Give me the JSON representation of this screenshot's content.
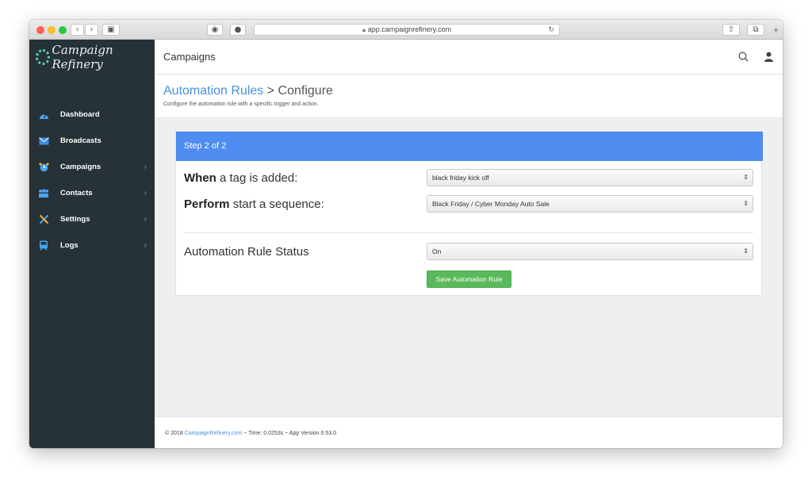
{
  "browser": {
    "url": "app.campaignrefinery.com",
    "colors": {
      "close": "#fd5f57",
      "minimize": "#febc2e",
      "zoom": "#28c840"
    }
  },
  "brand": {
    "name": "Campaign Refinery",
    "accent": "#5fd3a6"
  },
  "sidebar": {
    "items": [
      {
        "label": "Dashboard",
        "icon": "dashboard-icon",
        "chevron": false
      },
      {
        "label": "Broadcasts",
        "icon": "envelope-icon",
        "chevron": false
      },
      {
        "label": "Campaigns",
        "icon": "alarm-clock-icon",
        "chevron": true
      },
      {
        "label": "Contacts",
        "icon": "people-icon",
        "chevron": true
      },
      {
        "label": "Settings",
        "icon": "tools-icon",
        "chevron": true
      },
      {
        "label": "Logs",
        "icon": "train-icon",
        "chevron": true
      }
    ]
  },
  "topbar": {
    "title": "Campaigns"
  },
  "header": {
    "breadcrumb_link": "Automation Rules",
    "separator": ">",
    "breadcrumb_current": "Configure",
    "subtitle": "Configure the automation rule with a specific trigger and action."
  },
  "form": {
    "step_label": "Step 2 of 2",
    "step_color": "#4f8cf0",
    "when_bold": "When",
    "when_rest": "a tag is added:",
    "when_value": "black friday kick off",
    "perform_bold": "Perform",
    "perform_rest": "start a sequence:",
    "perform_value": "Black Friday / Cyber Monday Auto Sale",
    "status_label": "Automation Rule Status",
    "status_value": "On",
    "save_label": "Save Automation Rule",
    "save_color": "#5cb85c"
  },
  "footer": {
    "prefix": "© 2018",
    "link": "CampaignRefinery.com",
    "suffix": "~ Time: 0.0253s ~ App Version 0.53.0"
  }
}
